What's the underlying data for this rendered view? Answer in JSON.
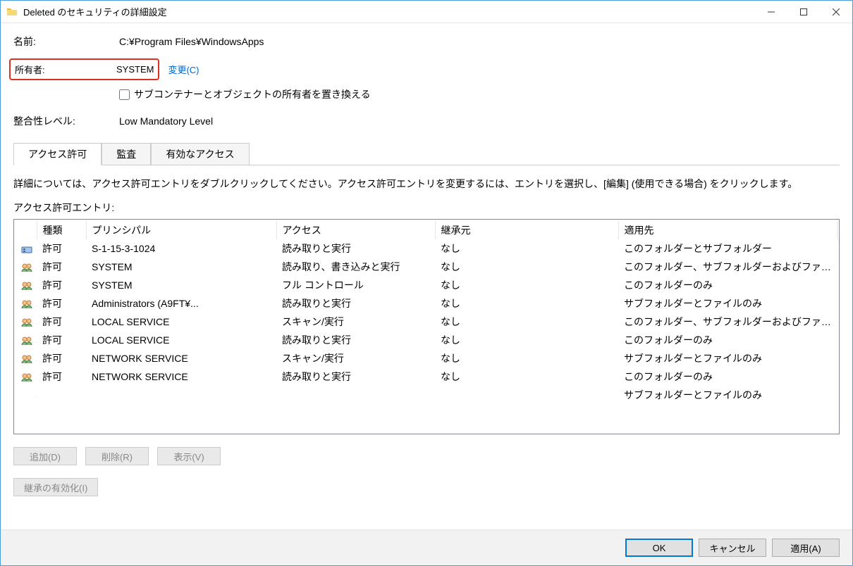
{
  "titlebar": {
    "title": "Deleted のセキュリティの詳細設定"
  },
  "info": {
    "name_label": "名前:",
    "name_value": "C:¥Program Files¥WindowsApps",
    "owner_label": "所有者:",
    "owner_value": "SYSTEM",
    "change_link": "変更(C)",
    "replace_checkbox_label": "サブコンテナーとオブジェクトの所有者を置き換える",
    "integrity_label": "整合性レベル:",
    "integrity_value": "Low Mandatory Level"
  },
  "tabs": {
    "permissions": "アクセス許可",
    "auditing": "監査",
    "effective": "有効なアクセス"
  },
  "hint": "詳細については、アクセス許可エントリをダブルクリックしてください。アクセス許可エントリを変更するには、エントリを選択し、[編集] (使用できる場合) をクリックします。",
  "entries_label": "アクセス許可エントリ:",
  "columns": {
    "type": "種類",
    "principal": "プリンシパル",
    "access": "アクセス",
    "inherited": "継承元",
    "applies": "適用先"
  },
  "entries": [
    {
      "icon": "sid",
      "type": "許可",
      "principal": "S-1-15-3-1024",
      "access": "読み取りと実行",
      "inherited": "なし",
      "applies": "このフォルダーとサブフォルダー"
    },
    {
      "icon": "group",
      "type": "許可",
      "principal": "SYSTEM",
      "access": "読み取り、書き込みと実行",
      "inherited": "なし",
      "applies": "このフォルダー、サブフォルダーおよびファイル"
    },
    {
      "icon": "group",
      "type": "許可",
      "principal": "SYSTEM",
      "access": "フル コントロール",
      "inherited": "なし",
      "applies": "このフォルダーのみ"
    },
    {
      "icon": "group",
      "type": "許可",
      "principal": "Administrators (A9FT¥...",
      "access": "読み取りと実行",
      "inherited": "なし",
      "applies": "サブフォルダーとファイルのみ"
    },
    {
      "icon": "group",
      "type": "許可",
      "principal": "LOCAL SERVICE",
      "access": "スキャン/実行",
      "inherited": "なし",
      "applies": "このフォルダー、サブフォルダーおよびファイル"
    },
    {
      "icon": "group",
      "type": "許可",
      "principal": "LOCAL SERVICE",
      "access": "読み取りと実行",
      "inherited": "なし",
      "applies": "このフォルダーのみ"
    },
    {
      "icon": "group",
      "type": "許可",
      "principal": "NETWORK SERVICE",
      "access": "スキャン/実行",
      "inherited": "なし",
      "applies": "サブフォルダーとファイルのみ"
    },
    {
      "icon": "group",
      "type": "許可",
      "principal": "NETWORK SERVICE",
      "access": "読み取りと実行",
      "inherited": "なし",
      "applies": "このフォルダーのみ"
    },
    {
      "icon": "",
      "type": "",
      "principal": "",
      "access": "",
      "inherited": "",
      "applies": "サブフォルダーとファイルのみ"
    }
  ],
  "buttons": {
    "add": "追加(D)",
    "remove": "削除(R)",
    "view": "表示(V)",
    "enable_inherit": "継承の有効化(I)",
    "ok": "OK",
    "cancel": "キャンセル",
    "apply": "適用(A)"
  }
}
